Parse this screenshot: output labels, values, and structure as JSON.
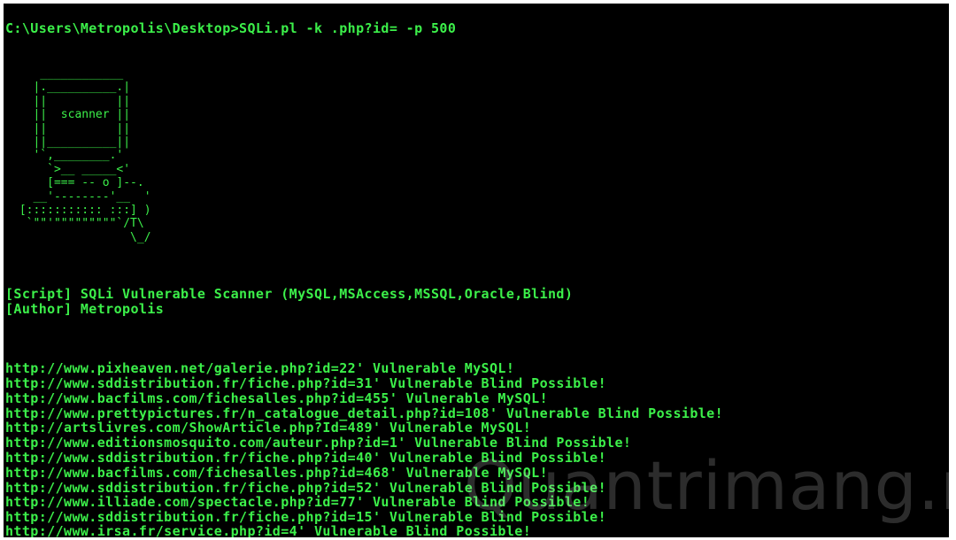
{
  "window": {
    "title": "",
    "background": "#000000",
    "text_color": "#3cf04a"
  },
  "prompt": {
    "text": "C:\\Users\\Metropolis\\Desktop>SQLi.pl -k .php?id= -p 500"
  },
  "ascii_art": {
    "lines": [
      "    ____________",
      "   |.__________.|",
      "   ||          ||",
      "   ||  scanner ||",
      "   ||          ||",
      "   ||__________||",
      "   '`,________.'",
      "     `>__ _____<'",
      "     [=== -- o ]--.",
      "   __'--------'__  '",
      " [::::::::::: :::] )",
      "  `\"\"'\"\"\"\"\"\"\"\"\"`/T\\",
      "                 \\_/"
    ],
    "label": "scanner"
  },
  "banner": {
    "script": "[Script] SQLi Vulnerable Scanner (MySQL,MSAccess,MSSQL,Oracle,Blind)",
    "author": "[Author] Metropolis"
  },
  "results": [
    "http://www.pixheaven.net/galerie.php?id=22' Vulnerable MySQL!",
    "http://www.sddistribution.fr/fiche.php?id=31' Vulnerable Blind Possible!",
    "http://www.bacfilms.com/fichesalles.php?id=455' Vulnerable MySQL!",
    "http://www.prettypictures.fr/n_catalogue_detail.php?id=108' Vulnerable Blind Possible!",
    "http://artslivres.com/ShowArticle.php?Id=489' Vulnerable MySQL!",
    "http://www.editionsmosquito.com/auteur.php?id=1' Vulnerable Blind Possible!",
    "http://www.sddistribution.fr/fiche.php?id=40' Vulnerable Blind Possible!",
    "http://www.bacfilms.com/fichesalles.php?id=468' Vulnerable MySQL!",
    "http://www.sddistribution.fr/fiche.php?id=52' Vulnerable Blind Possible!",
    "http://www.illiade.com/spectacle.php?id=77' Vulnerable Blind Possible!",
    "http://www.sddistribution.fr/fiche.php?id=15' Vulnerable Blind Possible!",
    "http://www.irsa.fr/service.php?id=4' Vulnerable Blind Possible!"
  ],
  "watermark": {
    "text": "Quantrimang.net"
  }
}
